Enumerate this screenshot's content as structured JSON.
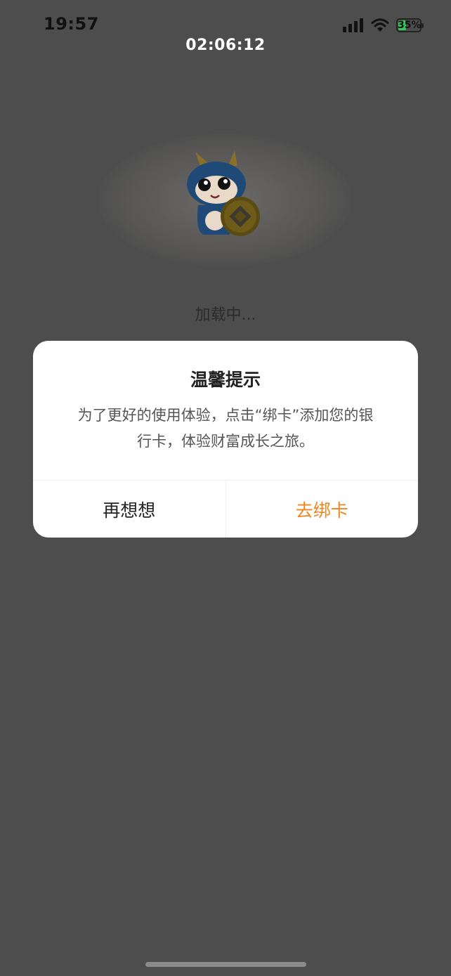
{
  "status_bar": {
    "time": "19:57",
    "battery_percent": "35%",
    "battery_level": 0.35,
    "icons": [
      "signal-icon",
      "wifi-icon",
      "battery-icon"
    ]
  },
  "overlay": {
    "timer": "02:06:12"
  },
  "loading": {
    "text": "加载中...",
    "mascot_icon": "dragon-mascot-icon"
  },
  "dialog": {
    "title": "温馨提示",
    "message_line1": "为了更好的使用体验，点击“绑卡”添加您的银",
    "message_line2": "行卡，体验财富成长之旅。",
    "cancel_label": "再想想",
    "confirm_label": "去绑卡"
  },
  "colors": {
    "mask": "#4d4d4d",
    "accent": "#f0861d",
    "dialog_bg": "#ffffff",
    "battery_fill": "#34c759"
  }
}
